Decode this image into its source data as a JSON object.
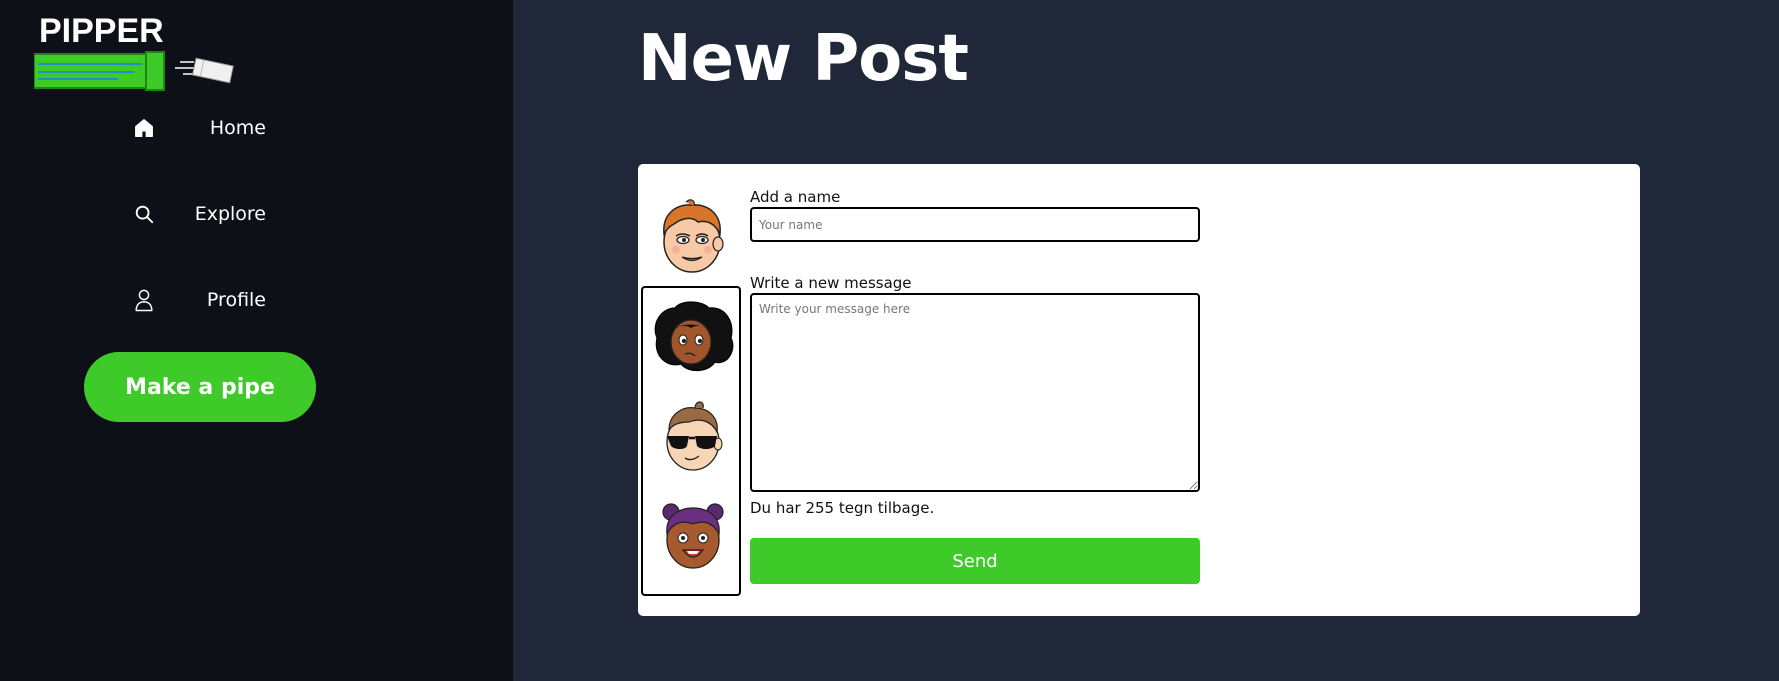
{
  "brand": {
    "logo_text": "PIPPER",
    "accent_color": "#3ecb29"
  },
  "sidebar": {
    "items": [
      {
        "label": "Home",
        "icon": "home-icon"
      },
      {
        "label": "Explore",
        "icon": "search-icon"
      },
      {
        "label": "Profile",
        "icon": "user-icon"
      }
    ],
    "cta_label": "Make a pipe"
  },
  "main": {
    "title": "New Post",
    "form": {
      "name_label": "Add a name",
      "name_placeholder": "Your name",
      "name_value": "",
      "message_label": "Write a new message",
      "message_placeholder": "Write your message here",
      "message_value": "",
      "char_count_text": "Du har 255 tegn tilbage.",
      "send_label": "Send"
    },
    "avatars": {
      "selected": "avatar-red-hair",
      "options": [
        "avatar-black-curly-hair",
        "avatar-sunglasses",
        "avatar-purple-hair"
      ]
    }
  }
}
